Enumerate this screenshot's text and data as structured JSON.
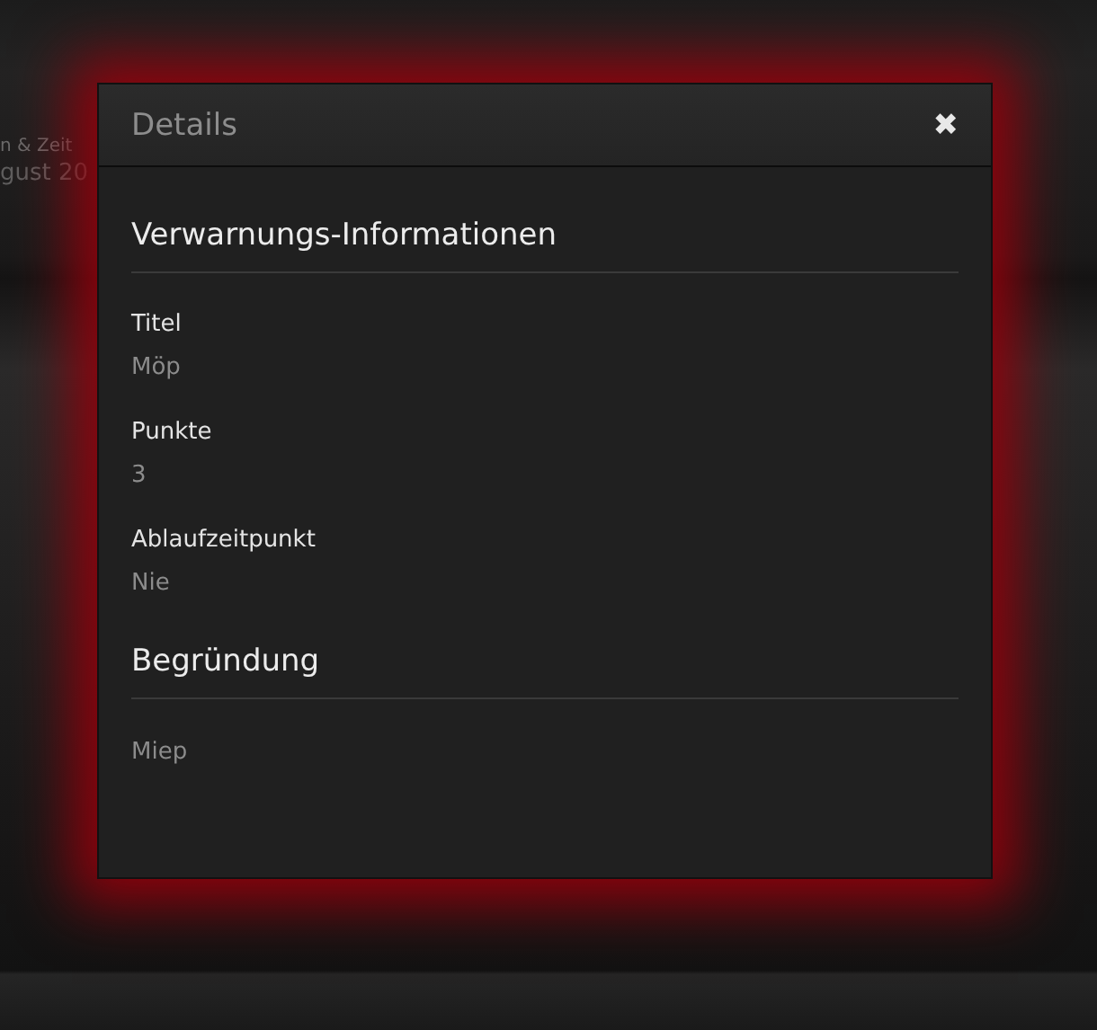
{
  "background": {
    "texts": [
      "n & Zeit",
      "gust 20"
    ]
  },
  "dialog": {
    "title": "Details",
    "close": "✖",
    "sections": [
      {
        "heading": "Verwarnungs-Informationen",
        "fields": [
          {
            "label": "Titel",
            "value": "Möp"
          },
          {
            "label": "Punkte",
            "value": "3"
          },
          {
            "label": "Ablaufzeitpunkt",
            "value": "Nie"
          }
        ]
      },
      {
        "heading": "Begründung",
        "text": "Miep"
      }
    ]
  }
}
